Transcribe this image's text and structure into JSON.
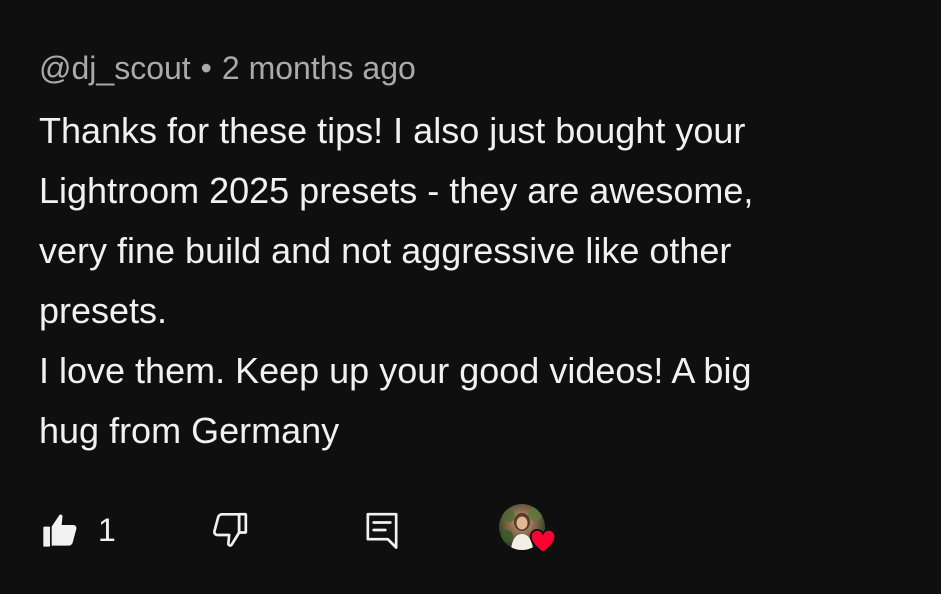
{
  "comment": {
    "author": "@dj_scout",
    "separator": "•",
    "timestamp": "2 months ago",
    "lines": [
      "Thanks for these tips! I also just bought your",
      "Lightroom 2025 presets - they are awesome,",
      "very fine build and not aggressive like other",
      "presets.",
      "I love them. Keep up your good videos! A big",
      "hug from Germany"
    ]
  },
  "actions": {
    "like_icon": "thumbs-up-filled-icon",
    "like_count": "1",
    "dislike_icon": "thumbs-down-outline-icon",
    "reply_icon": "reply-comment-icon",
    "creator_heart_icon": "red-heart-icon"
  },
  "colors": {
    "background": "#0f0f0f",
    "text_primary": "#f1f1f1",
    "text_secondary": "#aaaaaa",
    "heart": "#ff0033"
  }
}
